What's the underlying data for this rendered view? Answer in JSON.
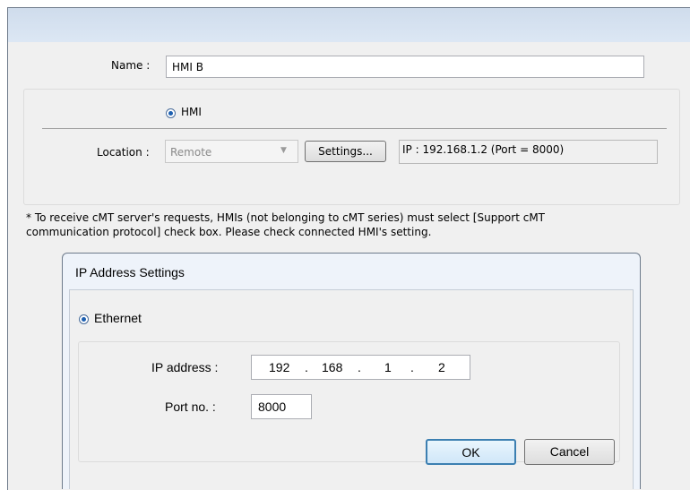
{
  "form": {
    "name_label": "Name :",
    "name_value": "HMI B",
    "hmi_radio_label": "HMI",
    "location_label": "Location :",
    "location_value": "Remote",
    "settings_button": "Settings...",
    "ip_summary": "IP : 192.168.1.2 (Port = 8000)"
  },
  "note": {
    "line1": "* To receive cMT server's requests, HMIs (not belonging to cMT series) must select [Support cMT",
    "line2": "communication protocol] check box. Please check connected HMI's setting."
  },
  "dialog": {
    "title": "IP Address Settings",
    "ethernet_radio_label": "Ethernet",
    "ip_label": "IP address :",
    "ip_octets": [
      "192",
      "168",
      "1",
      "2"
    ],
    "ip_dots": [
      ".",
      ".",
      "."
    ],
    "port_label": "Port no. :",
    "port_value": "8000",
    "ok_button": "OK",
    "cancel_button": "Cancel"
  }
}
